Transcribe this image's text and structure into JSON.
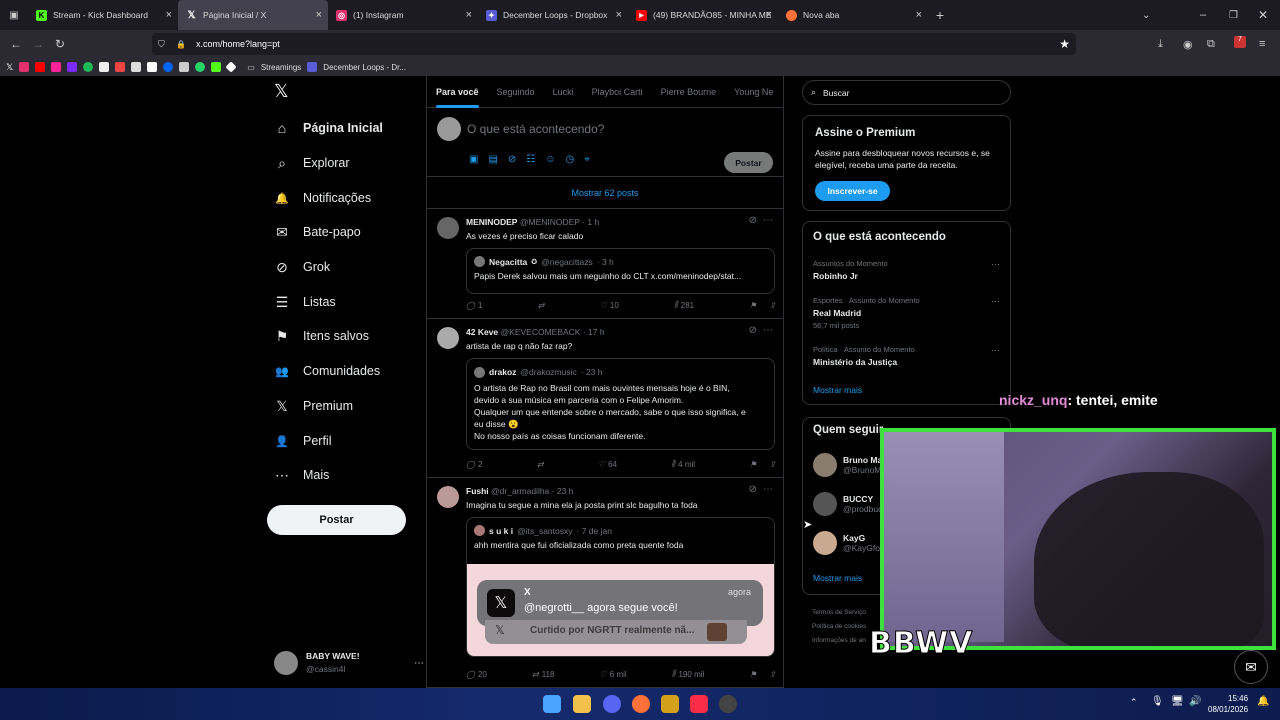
{
  "browser": {
    "tabs": [
      {
        "title": "Stream - Kick Dashboard",
        "color": "#53fc18",
        "glyph": "K"
      },
      {
        "title": "Página Inicial / X",
        "color": "#ffffff",
        "glyph": "𝕏"
      },
      {
        "title": "(1) Instagram",
        "color": "#e1306c",
        "glyph": "◎"
      },
      {
        "title": "December Loops - Dropbox",
        "color": "#5b5bd6",
        "glyph": "✦"
      },
      {
        "title": "(49) BRANDÃO85 - MINHA ME",
        "color": "#ff0000",
        "glyph": "▶"
      },
      {
        "title": "Nova aba",
        "color": "#ff7139",
        "glyph": "●"
      }
    ],
    "url": "x.com/home?lang=pt",
    "bookmarks": {
      "folder": "Streamings",
      "item": "December Loops - Dr..."
    },
    "badge_count": "7"
  },
  "nav": {
    "items": [
      {
        "label": "Página Inicial",
        "icon": "home-icon",
        "glyph": "⌂"
      },
      {
        "label": "Explorar",
        "icon": "search-icon",
        "glyph": "⌕"
      },
      {
        "label": "Notificações",
        "icon": "bell-icon",
        "glyph": "🔔"
      },
      {
        "label": "Bate-papo",
        "icon": "mail-icon",
        "glyph": "✉"
      },
      {
        "label": "Grok",
        "icon": "grok-icon",
        "glyph": "⊘"
      },
      {
        "label": "Listas",
        "icon": "list-icon",
        "glyph": "☰"
      },
      {
        "label": "Itens salvos",
        "icon": "bookmark-icon",
        "glyph": "⚑"
      },
      {
        "label": "Comunidades",
        "icon": "communities-icon",
        "glyph": "👥"
      },
      {
        "label": "Premium",
        "icon": "x-icon",
        "glyph": "𝕏"
      },
      {
        "label": "Perfil",
        "icon": "profile-icon",
        "glyph": "👤"
      },
      {
        "label": "Mais",
        "icon": "more-icon",
        "glyph": "⋯"
      }
    ],
    "post_button": "Postar",
    "account": {
      "name": "BABY WAVE!",
      "handle": "@cassin4l"
    }
  },
  "timeline": {
    "tabs": [
      "Para você",
      "Seguindo",
      "Lucki",
      "Playboi Carti",
      "Pierre Bourne",
      "Young Ne"
    ],
    "composer_placeholder": "O que está acontecendo?",
    "composer_post": "Postar",
    "show_posts": "Mostrar 62 posts",
    "tweets": [
      {
        "name": "MENINODEP",
        "handle": "@MENINODEP",
        "time": "· 1 h",
        "text": "As vezes é preciso ficar calado",
        "quote": {
          "name": "Negacitta",
          "handle": "@negacittazs",
          "time": "· 3 h",
          "lines": [
            "Papis Derek salvou mais um neguinho do CLT x.com/meninodep/stat..."
          ]
        },
        "actions": {
          "reply": "1",
          "retweet": "",
          "like": "10",
          "views": "281"
        }
      },
      {
        "name": "42 Keve",
        "handle": "@KEVECOMEBACK",
        "time": "· 17 h",
        "text": "artista de rap q não faz rap?",
        "quote": {
          "name": "drakoz",
          "handle": "@drakozmusic",
          "time": "· 23 h",
          "lines": [
            "O artista de Rap no Brasil com mais ouvintes mensais hoje é o BIN,",
            "devido a sua música em parceria com o Felipe Amorim.",
            "Qualquer um que entende sobre o mercado, sabe o que isso significa, e",
            "eu disse 😮",
            "No nosso país as coisas funcionam diferente."
          ]
        },
        "actions": {
          "reply": "2",
          "retweet": "",
          "like": "64",
          "views": "4 mil"
        }
      },
      {
        "name": "Fushi",
        "handle": "@dr_armadilha",
        "time": "· 23 h",
        "text": "Imagina tu segue a mina ela ja posta print slc bagulho ta foda",
        "quote": {
          "name": "s u k i",
          "handle": "@its_santosxy",
          "time": "· 7 de jan",
          "lines": [
            "ahh mentira que fui oficializada como preta quente foda"
          ]
        },
        "actions": {
          "reply": "20",
          "retweet": "118",
          "like": "6 mil",
          "views": "190 mil"
        }
      }
    ],
    "toast": {
      "app": "X",
      "time": "agora",
      "message": "@negrotti__ agora segue você!",
      "under": "Curtido por NGRTT  realmente nã..."
    }
  },
  "sidebar": {
    "search_placeholder": "Buscar",
    "premium": {
      "title": "Assine o Premium",
      "body": "Assine para desbloquear novos recursos e, se elegível, receba uma parte da receita.",
      "button": "Inscrever-se"
    },
    "trends": {
      "title": "O que está acontecendo",
      "items": [
        {
          "context": "Assuntos do Momento",
          "topic": "Robinho Jr",
          "posts": ""
        },
        {
          "context": "Esportes · Assunto do Momento",
          "topic": "Real Madrid",
          "posts": "56,7 mil posts"
        },
        {
          "context": "Política · Assunto do Momento",
          "topic": "Ministério da Justiça",
          "posts": ""
        }
      ],
      "more": "Mostrar mais"
    },
    "follow": {
      "title": "Quem seguir",
      "users": [
        {
          "name": "Bruno Ma",
          "handle": "@BrunoM"
        },
        {
          "name": "BUCCY",
          "handle": "@prodbuc"
        },
        {
          "name": "KayG",
          "handle": "@KayGfo"
        }
      ],
      "more": "Mostrar mais"
    },
    "footer": [
      "Termos de Serviço",
      "Política de cookies",
      "Informações de an"
    ]
  },
  "overlay": {
    "chat_user": "nickz_unq",
    "chat_text": ": tentei, emite",
    "brand": "BBWV"
  },
  "taskbar": {
    "time": "15:46",
    "date": "08/01/2026"
  }
}
